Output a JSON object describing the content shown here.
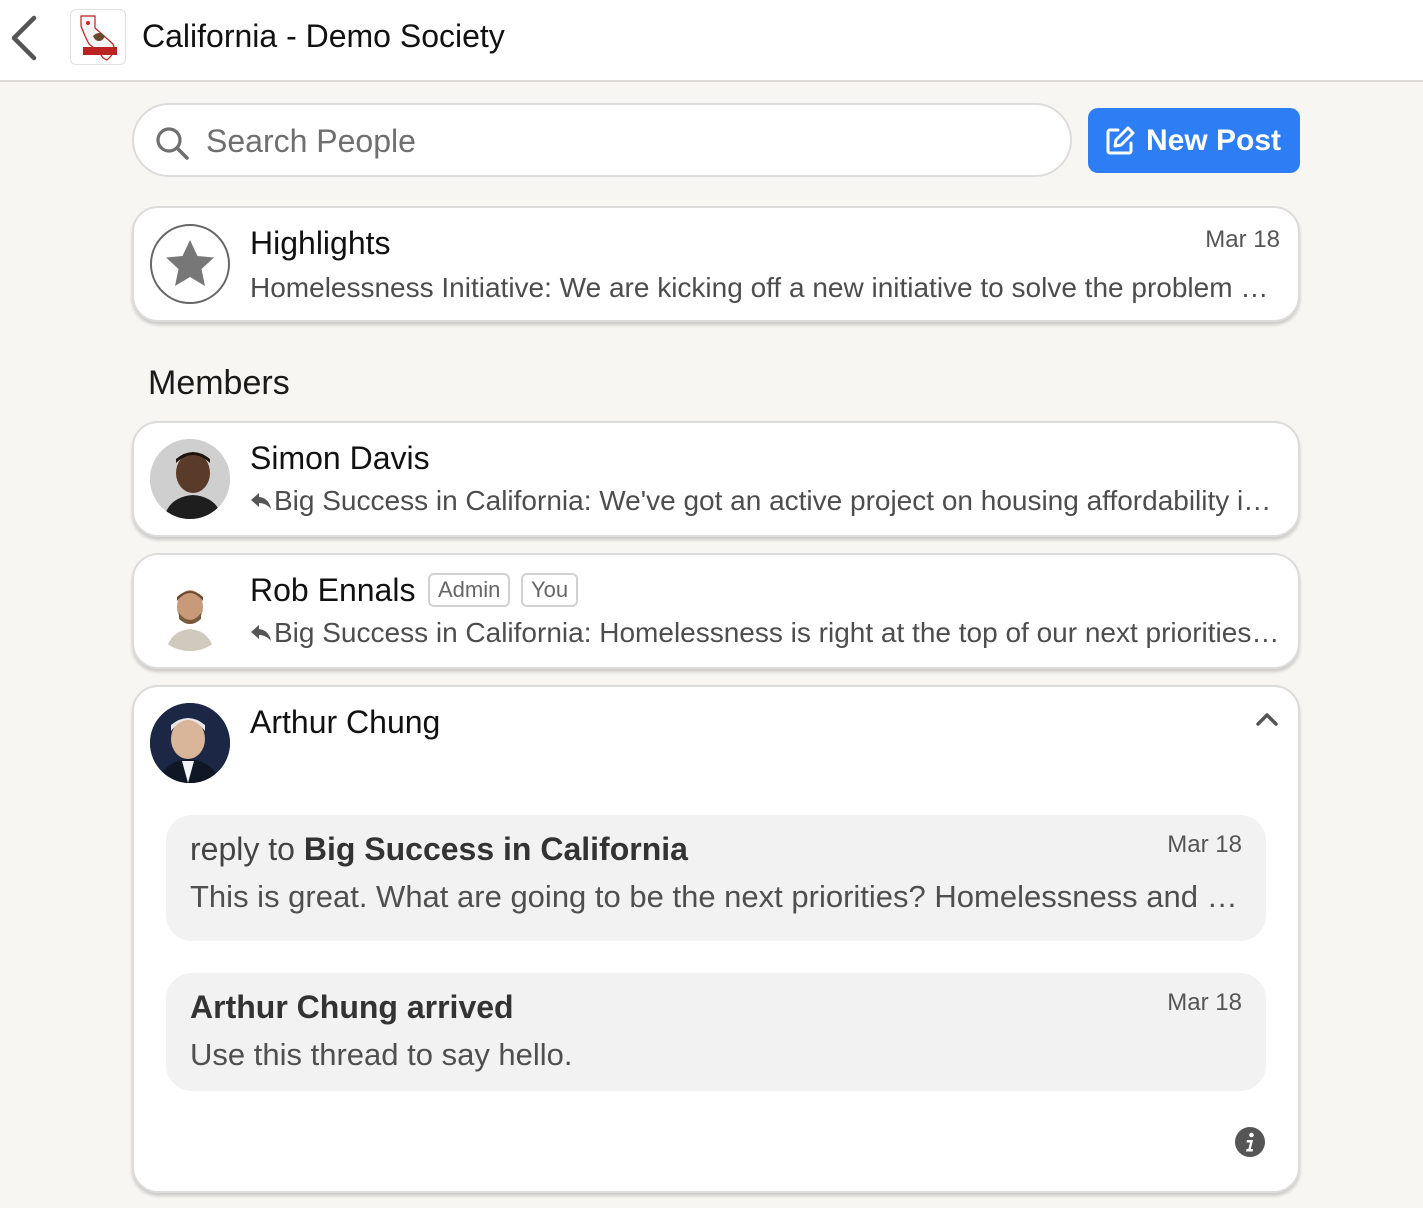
{
  "header": {
    "title": "California - Demo Society",
    "back_icon": "chevron-left-icon",
    "logo_icon": "california-flag-icon"
  },
  "search": {
    "placeholder": "Search People",
    "icon": "search-icon"
  },
  "new_post": {
    "label": "New Post",
    "icon": "edit-square-icon",
    "color": "#2d7df5"
  },
  "highlights": {
    "title": "Highlights",
    "date": "Mar 18",
    "text": "Homelessness Initiative: We are kicking off a new initiative to solve the problem of homelessness in California",
    "icon": "star-icon"
  },
  "members_heading": "Members",
  "members": [
    {
      "name": "Simon Davis",
      "preview": "Big Success in California: We've got an active project on housing affordability in the state",
      "badges": []
    },
    {
      "name": "Rob Ennals",
      "preview": "Big Success in California: Homelessness is right at the top of our next priorities list",
      "badges": [
        "Admin",
        "You"
      ]
    }
  ],
  "expanded_member": {
    "name": "Arthur Chung",
    "collapse_icon": "chevron-up-icon",
    "info_icon": "info-icon",
    "messages": [
      {
        "prefix": "reply to",
        "title": "Big Success in California",
        "date": "Mar 18",
        "text": "This is great. What are going to be the next priorities? Homelessness and housing costs?"
      },
      {
        "prefix": "",
        "title": "Arthur Chung arrived",
        "date": "Mar 18",
        "text": "Use this thread to say hello."
      }
    ]
  }
}
